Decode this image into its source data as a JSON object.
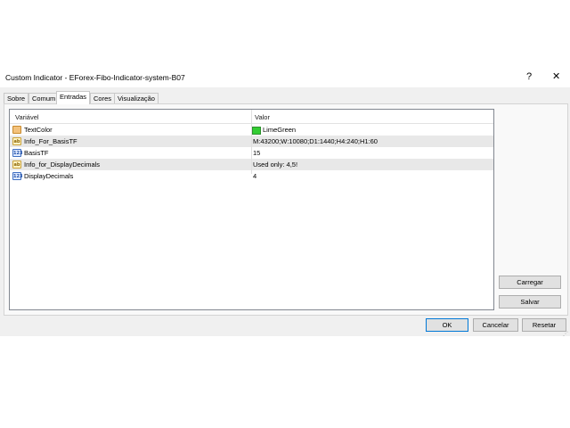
{
  "window": {
    "title": "Custom Indicator - EForex-Fibo-Indicator-system-B07",
    "help_label": "?",
    "close_label": "✕"
  },
  "tabs": [
    {
      "label": "Sobre"
    },
    {
      "label": "Comum"
    },
    {
      "label": "Entradas"
    },
    {
      "label": "Cores"
    },
    {
      "label": "Visualização"
    }
  ],
  "active_tab": "Entradas",
  "grid": {
    "headers": {
      "variable": "Variável",
      "value": "Valor"
    },
    "rows": [
      {
        "icon": "color-icon",
        "name": "TextColor",
        "value": "LimeGreen",
        "swatch": "#32cd32"
      },
      {
        "icon": "ab-icon",
        "icon_text": "ab",
        "name": "Info_For_BasisTF",
        "value": "M:43200;W:10080;D1:1440;H4:240;H1:60"
      },
      {
        "icon": "number-icon",
        "icon_text": "123",
        "name": "BasisTF",
        "value": "15"
      },
      {
        "icon": "ab-icon",
        "icon_text": "ab",
        "name": "Info_for_DisplayDecimals",
        "value": "Used only: 4,5!"
      },
      {
        "icon": "number-icon",
        "icon_text": "123",
        "name": "DisplayDecimals",
        "value": "4"
      }
    ]
  },
  "side_buttons": {
    "load": "Carregar",
    "save": "Salvar"
  },
  "footer_buttons": {
    "ok": "OK",
    "cancel": "Cancelar",
    "reset": "Resetar"
  },
  "colors": {
    "accent": "#0078d7",
    "row_alt": "#e8e8e8",
    "dialog_bg": "#f0f0f0"
  }
}
